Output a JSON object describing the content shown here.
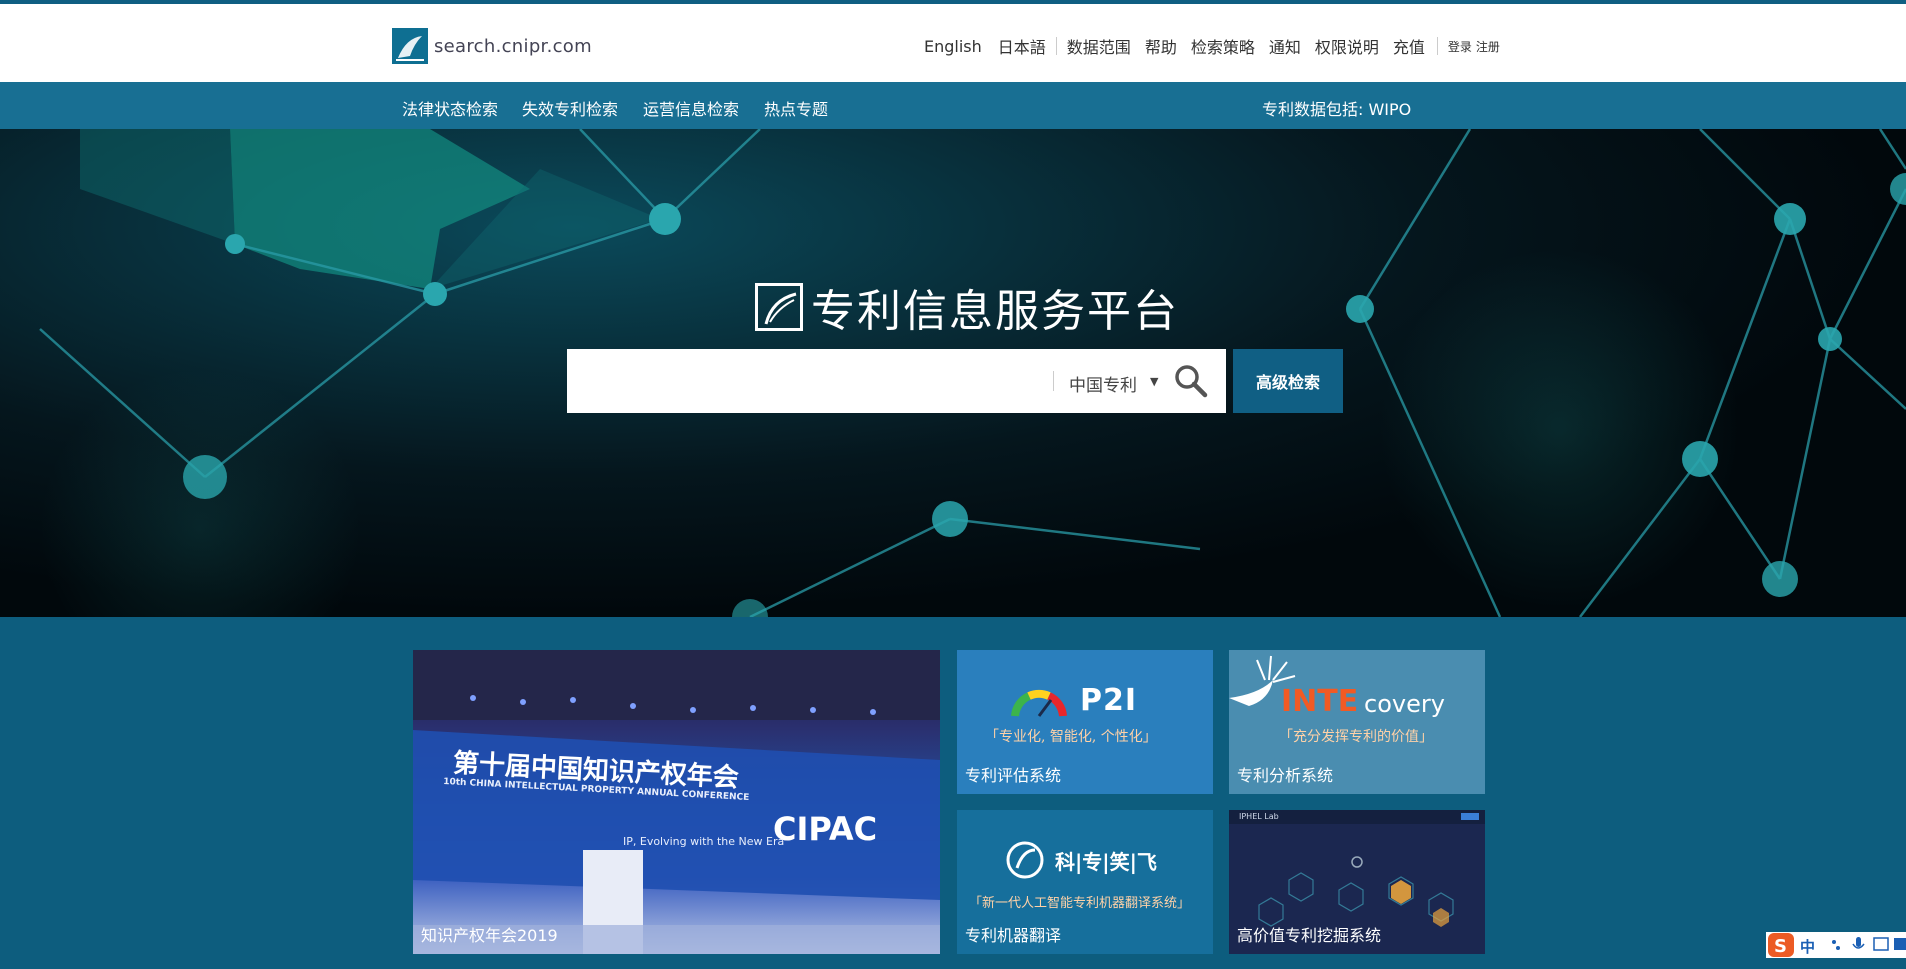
{
  "header": {
    "logo_text": "search.cnipr.com",
    "links": [
      "English",
      "日本語",
      "数据范围",
      "帮助",
      "检索策略",
      "通知",
      "权限说明",
      "充值"
    ],
    "login": "登录",
    "register": "注册"
  },
  "nav": {
    "items": [
      "法律状态检索",
      "失效专利检索",
      "运营信息检索",
      "热点专题"
    ],
    "right_text": "专利数据包括: WIPO"
  },
  "hero": {
    "title": "专利信息服务平台",
    "search": {
      "placeholder": "",
      "scope": "中国专利"
    },
    "advanced_button": "高级检索"
  },
  "tiles": [
    {
      "label": "知识产权年会2019",
      "banner_title": "第十届中国知识产权年会",
      "banner_en": "10th CHINA INTELLECTUAL PROPERTY ANNUAL CONFERENCE",
      "banner_logo": "CIPAC",
      "banner_slogan": "IP, Evolving with the New Era"
    },
    {
      "label": "专利评估系统",
      "brand": "P2I",
      "slogan": "「专业化, 智能化, 个性化」"
    },
    {
      "label": "专利分析系统",
      "brand_a": "INTE",
      "brand_b": "covery",
      "slogan": "「充分发挥专利的价值」"
    },
    {
      "label": "专利机器翻译",
      "brand": "科|专|笑|飞",
      "slogan": "「新一代人工智能专利机器翻译系统」"
    },
    {
      "label": "高价值专利挖掘系统",
      "brand": "IPHEL Lab"
    }
  ],
  "ime": {
    "label": "中"
  },
  "colors": {
    "brand": "#186f93",
    "page_bg": "#0d5d7e",
    "accent_orange": "#f15a24"
  }
}
